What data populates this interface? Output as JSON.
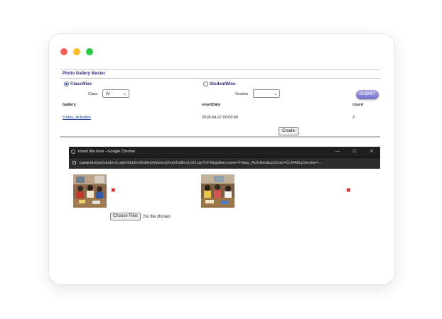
{
  "window": {
    "controls": [
      "close",
      "minimize",
      "maximize"
    ]
  },
  "panel": {
    "title": "Photo Gallery Master"
  },
  "mode": {
    "options": [
      {
        "label": "ClassWise",
        "selected": true
      },
      {
        "label": "StudentWise",
        "selected": false
      }
    ]
  },
  "filters": {
    "class_label": "Class",
    "class_value": "IV",
    "section_label": "Section",
    "section_value": "",
    "submit_label": "SUBMIT"
  },
  "table": {
    "headers": [
      "Gallery",
      "eventDate",
      "count"
    ],
    "rows": [
      {
        "gallery": "Friday_Activities",
        "eventDate": "2018-04-27 00:00:00",
        "count": "2"
      }
    ]
  },
  "create_label": "Create",
  "popup": {
    "title": "Insert title here - Google Chrome",
    "url_host": "cserp.in",
    "url_path": "/sdps/studentLogin/StudentGalleryMaster/photoGalleryList2.jsp?id=6&galleryname=Friday_Activities&upClass=CLM4&upSection=...",
    "choose_files_label": "Choose Files",
    "no_file_label": "No file chosen",
    "photos": [
      {
        "icon": "classroom-photo"
      },
      {
        "icon": "classroom-photo"
      }
    ],
    "remove_icon": "✖"
  },
  "colors": {
    "accent": "#2b2b7a",
    "link": "#1a3e96",
    "remove": "#d11a1a",
    "submit": "#7470c9"
  }
}
